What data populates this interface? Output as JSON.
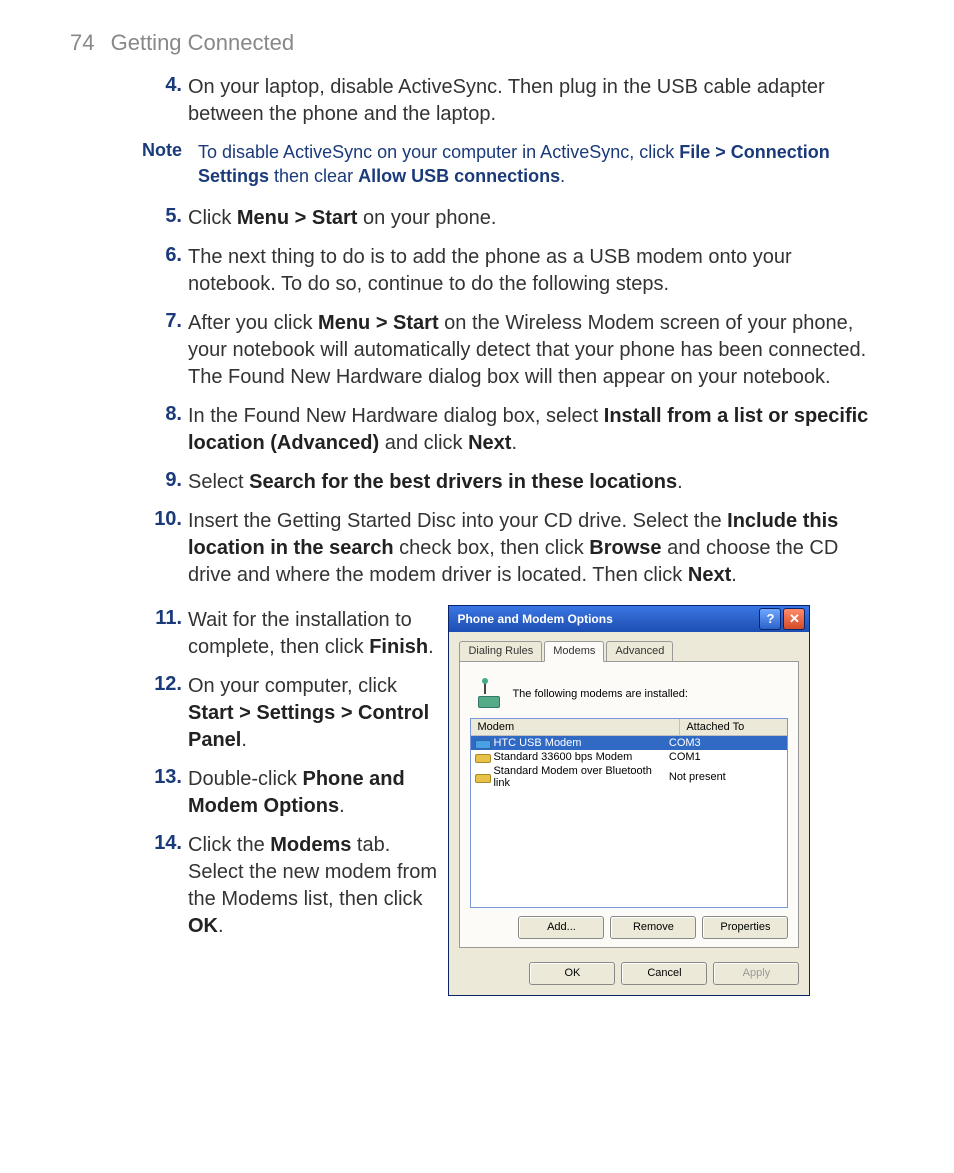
{
  "header": {
    "page_number": "74",
    "section_title": "Getting Connected"
  },
  "steps": {
    "s4": {
      "num": "4.",
      "text_a": "On your laptop, disable ActiveSync. Then plug in the USB cable adapter between the phone and the laptop."
    },
    "s5": {
      "num": "5.",
      "text_a": "Click ",
      "bold_a": "Menu > Start",
      "text_b": " on your phone."
    },
    "s6": {
      "num": "6.",
      "text_a": "The next thing to do is to add the phone as a USB modem onto your notebook. To do so, continue to do the following steps."
    },
    "s7": {
      "num": "7.",
      "text_a": "After you click ",
      "bold_a": "Menu > Start",
      "text_b": " on the Wireless Modem screen of your phone, your notebook will automatically detect that your phone has been connected. The Found New Hardware dialog box will then appear on your notebook."
    },
    "s8": {
      "num": "8.",
      "text_a": "In the Found New Hardware dialog box, select ",
      "bold_a": "Install from a list or specific location (Advanced)",
      "text_b": " and click ",
      "bold_b": "Next",
      "text_c": "."
    },
    "s9": {
      "num": "9.",
      "text_a": "Select ",
      "bold_a": "Search for the best drivers in these locations",
      "text_b": "."
    },
    "s10": {
      "num": "10.",
      "text_a": "Insert the Getting Started Disc into your CD drive. Select the ",
      "bold_a": "Include this location in the search",
      "text_b": " check box, then click ",
      "bold_b": "Browse",
      "text_c": " and choose the CD drive and where the modem driver is located. Then click ",
      "bold_c": "Next",
      "text_d": "."
    },
    "s11": {
      "num": "11.",
      "text_a": "Wait for the installation to complete, then click ",
      "bold_a": "Finish",
      "text_b": "."
    },
    "s12": {
      "num": "12.",
      "text_a": "On your computer, click ",
      "bold_a": "Start > Settings > Control Panel",
      "text_b": "."
    },
    "s13": {
      "num": "13.",
      "text_a": "Double-click ",
      "bold_a": "Phone and Modem Options",
      "text_b": "."
    },
    "s14": {
      "num": "14.",
      "text_a": "Click the ",
      "bold_a": "Modems",
      "text_b": " tab. Select the new modem from the Modems list, then click ",
      "bold_b": "OK",
      "text_c": "."
    }
  },
  "note": {
    "label": "Note",
    "text_a": "To disable ActiveSync on your computer in ActiveSync, click ",
    "bold_a": "File > Connection Settings",
    "text_b": " then clear ",
    "bold_b": "Allow USB connections",
    "text_c": "."
  },
  "dialog": {
    "title": "Phone and Modem Options",
    "tabs": {
      "dialing": "Dialing Rules",
      "modems": "Modems",
      "advanced": "Advanced"
    },
    "message": "The following modems are installed:",
    "columns": {
      "modem": "Modem",
      "attached": "Attached To"
    },
    "rows": [
      {
        "name": "HTC USB Modem",
        "attached": "COM3",
        "selected": true,
        "icon": "globe"
      },
      {
        "name": "Standard 33600 bps Modem",
        "attached": "COM1",
        "selected": false,
        "icon": "std"
      },
      {
        "name": "Standard Modem over Bluetooth link",
        "attached": "Not present",
        "selected": false,
        "icon": "std"
      }
    ],
    "buttons": {
      "add": "Add...",
      "remove": "Remove",
      "properties": "Properties",
      "ok": "OK",
      "cancel": "Cancel",
      "apply": "Apply"
    }
  }
}
